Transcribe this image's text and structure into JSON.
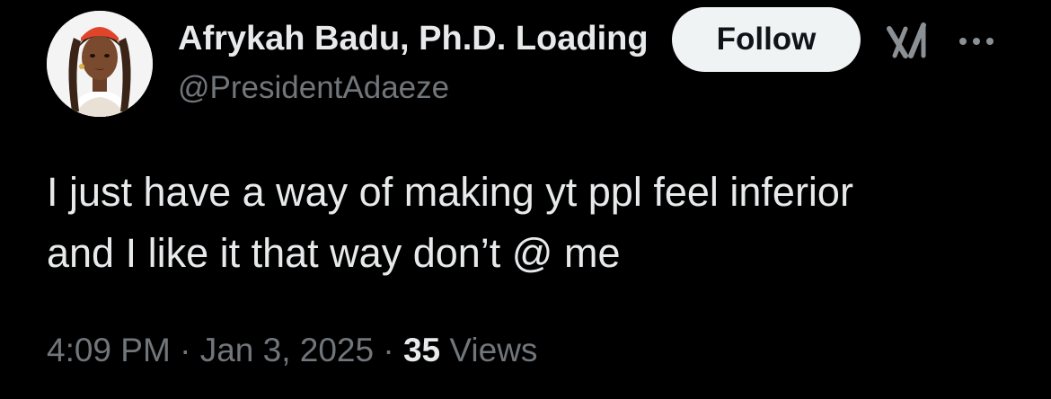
{
  "author": {
    "display_name": "Afrykah Badu, Ph.D. Loading",
    "handle": "@PresidentAdaeze",
    "avatar_icon": "avatar-illustration"
  },
  "actions": {
    "follow_label": "Follow",
    "grok_icon": "grok-icon",
    "more_icon": "more-options-icon"
  },
  "tweet": {
    "lines": [
      "I just have a way of making yt ppl feel inferior",
      "and I like it that way don’t @ me"
    ]
  },
  "meta": {
    "time": "4:09 PM",
    "separator": " · ",
    "date": "Jan 3, 2025",
    "views_count": "35",
    "views_label": " Views"
  },
  "colors": {
    "background": "#000000",
    "primary_text": "#e7e9ea",
    "secondary_text": "#71767b",
    "button_bg": "#eff3f4",
    "button_text": "#0f1419"
  }
}
